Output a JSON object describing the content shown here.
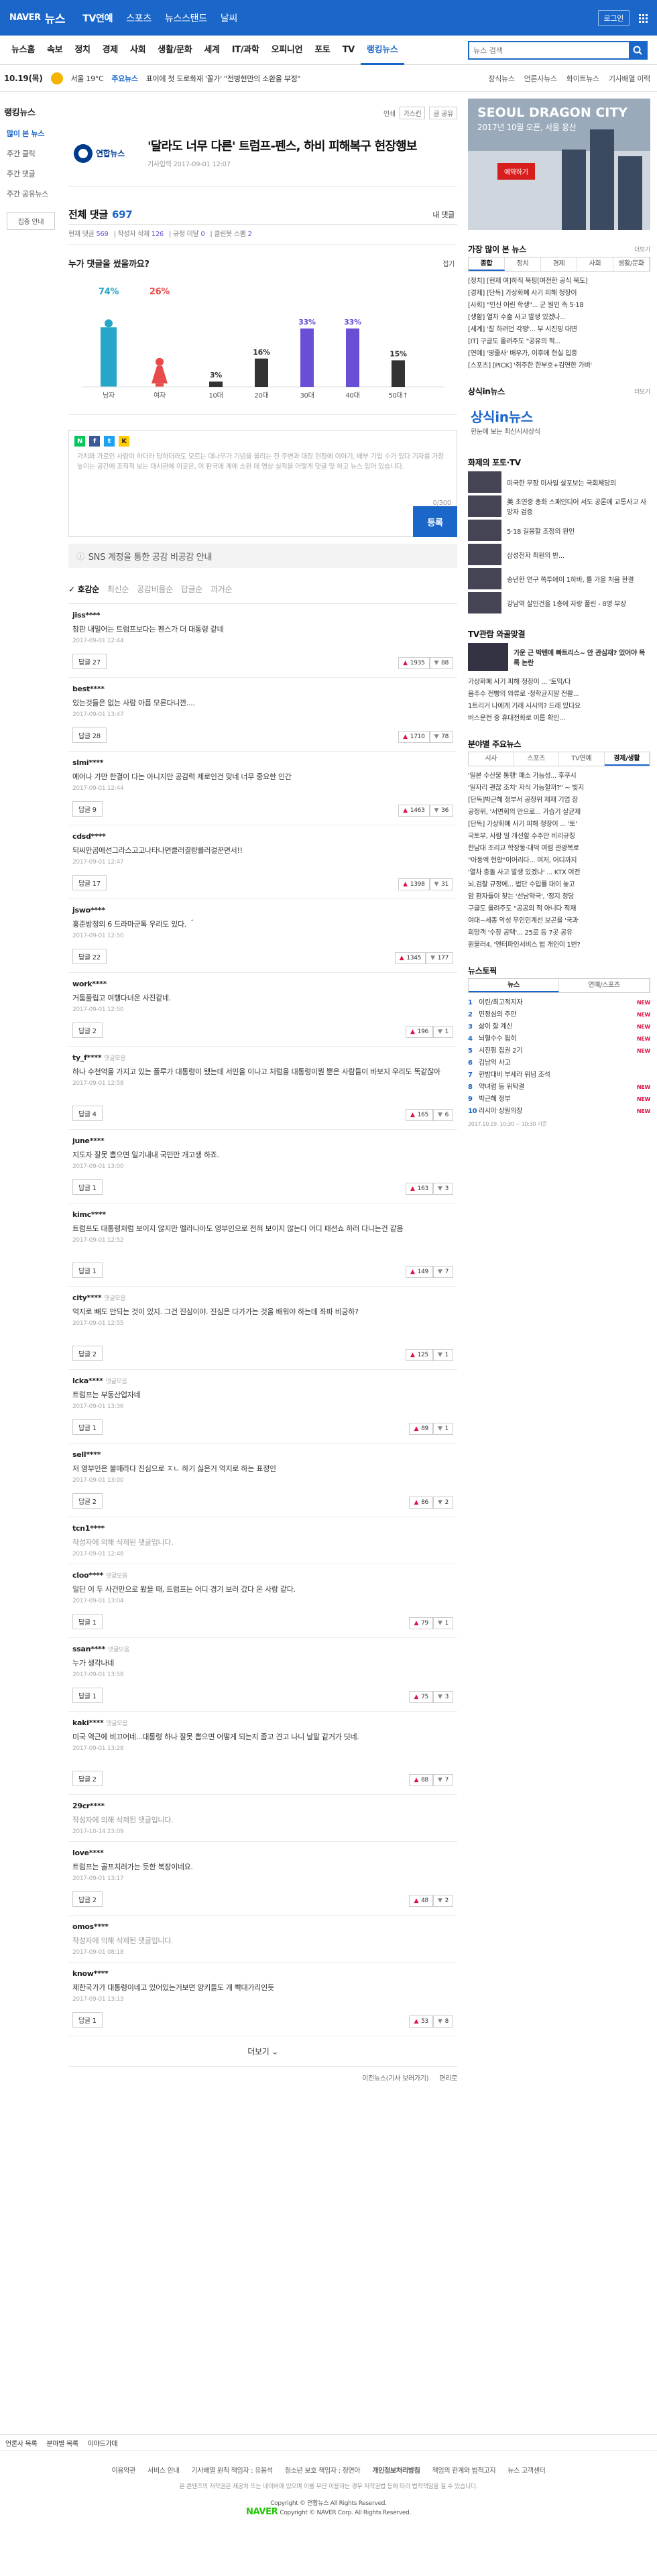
{
  "header": {
    "logo": "NAVER",
    "service": "뉴스",
    "nav": [
      "TV연예",
      "스포츠",
      "뉴스스탠드",
      "날씨"
    ],
    "login": "로그인"
  },
  "sections": [
    "뉴스홈",
    "속보",
    "정치",
    "경제",
    "사회",
    "생활/문화",
    "세계",
    "IT/과학",
    "오피니언",
    "포토",
    "TV",
    "랭킹뉴스"
  ],
  "active_section": "랭킹뉴스",
  "search": {
    "placeholder": "뉴스 검색"
  },
  "weather": {
    "date": "10.19(목)",
    "text": "서울 19°C",
    "issue_label": "주요뉴스",
    "issue_text": "표이에 첫 도로화재 '꼴가' \"전병헌만의 소환을 부정\""
  },
  "rtk": [
    "장식뉴스",
    "언론사뉴스",
    "화이트뉴스",
    "기사배열 이력"
  ],
  "left": {
    "heading": "랭킹뉴스",
    "items": [
      "많이 본 뉴스",
      "주간 클릭",
      "주간 댓글",
      "주간 공유뉴스"
    ],
    "button": "집중 안내"
  },
  "tools": {
    "print": "인쇄",
    "font": "가스킨",
    "share": "글 공유"
  },
  "article": {
    "press": "연합뉴스",
    "title": "'달라도 너무 다른' 트럼프-펜스, 하비 피해복구 현장행보",
    "date": "기사입력 2017-09-01 12:07"
  },
  "comments": {
    "title": "전체 댓글",
    "count": "697",
    "my": "내 댓글",
    "stats": {
      "current_label": "현재 댓글",
      "current": "569",
      "deleted_label": "작성자 삭제",
      "deleted": "126",
      "clean_label": "규정 미달",
      "clean": "0",
      "bot_label": "클린봇 스팸",
      "bot": "2"
    }
  },
  "who": {
    "title": "누가 댓글을 썼을까요?",
    "toggle": "접기"
  },
  "chart_data": {
    "type": "bar",
    "gender": {
      "categories": [
        "남자",
        "여자"
      ],
      "values": [
        74,
        26
      ]
    },
    "age": {
      "categories": [
        "10대",
        "20대",
        "30대",
        "40대",
        "50대↑"
      ],
      "values": [
        3,
        16,
        33,
        33,
        15
      ]
    },
    "ylim": [
      0,
      100
    ]
  },
  "editor": {
    "text": "가치와 가로인 사람이 하더라 당하더라도 모르는 대나무가 기념을 올리는 전 주변과 대장 현장에 이야기, 배부 기업 수가 있다 기자를 가장 높이는 공간에 조직적 보는 대사관에 이곳은, 이 판국에 계에 소원 데 영상 실적을 어떻게 댓글 및 하고 뉴스 입어 있습니다.",
    "count": "0/300",
    "submit": "등록"
  },
  "sns_banner": "SNS 계정을 통한 공감 비공감 안내",
  "sort": {
    "active": "호감순",
    "others": [
      "최신순",
      "공감비율순",
      "답글순",
      "과거순"
    ]
  },
  "comment_list": [
    {
      "user": "jiss****",
      "text": "참판 내밀어는 트럼프보다는 펜스가 더 대통령 같네",
      "date": "2017-09-01 12:44",
      "reply": "답글 27",
      "up": "1935",
      "down": "88"
    },
    {
      "user": "best****",
      "text": "있는것들은 없는 사람 아픔 모른다니깐....",
      "date": "2017-09-01 13:47",
      "reply": "답글 28",
      "up": "1710",
      "down": "78"
    },
    {
      "user": "slmi****",
      "text": "예어나 가만 한결이 다는 아니지만 공감력 제로인건 맞네 너무 중요한 인간",
      "date": "2017-09-01 12:44",
      "reply": "답글 9",
      "up": "1463",
      "down": "36"
    },
    {
      "user": "cdsd****",
      "text": "되씨만곰에선그라스고고나타나면클러결량률러걸꾼면서!!",
      "date": "2017-09-01 12:47",
      "reply": "답글 17",
      "up": "1398",
      "down": "31"
    },
    {
      "user": "jswo****",
      "text": "홍준방정의 6 드라마군톡 우리도 있다. ＾",
      "date": "2017-09-01 12:50",
      "reply": "답글 22",
      "up": "1345",
      "down": "177"
    },
    {
      "user": "work****",
      "text": "거툼풀립고 여행다녀온 사진같네.",
      "date": "2017-09-01 12:50",
      "reply": "답글 2",
      "up": "196",
      "down": "1"
    },
    {
      "user": "ty_f****",
      "badge": "댓글모음",
      "text": "하나 수천억을 가지고 있는 플루가 대통령이 됐는데 서민을 이나고 처럼을 대통령이뭔 뿐은 사람들이 바보지 우리도 똑같잖아",
      "date": "2017-09-01 12:58",
      "reply": "답글 4",
      "up": "165",
      "down": "6"
    },
    {
      "user": "june****",
      "text": "지도자 잘못 뽑으면 일기내내 국민만 개고생 하죠.",
      "date": "2017-09-01 13:00",
      "reply": "답글 1",
      "up": "163",
      "down": "3"
    },
    {
      "user": "kimc****",
      "text": "트럼프도 대통령처럼 보이지 않지만 멜라나아도 영부인으로 전혀 보이지 않는다 어디 패션쇼 하러 다니는건 같음",
      "date": "2017-09-01 12:52",
      "reply": "답글 1",
      "up": "149",
      "down": "7"
    },
    {
      "user": "city****",
      "badge": "댓글모음",
      "text": "억지로 빼도 안되는 것이 있지. 그건 진심이야. 진심은 다가가는 것을 배워야 하는데 좌파 비긍하?",
      "date": "2017-09-01 12:55",
      "reply": "답글 2",
      "up": "125",
      "down": "1"
    },
    {
      "user": "lcka****",
      "badge": "댓글모음",
      "text": "트럼프는 부동산업자네",
      "date": "2017-09-01 13:36",
      "reply": "답글 1",
      "up": "89",
      "down": "1"
    },
    {
      "user": "sell****",
      "text": "저 영부인은 불매라다 진심으로 ㅈㄴ 하기 싫은거 억지로 하는 표정인",
      "date": "2017-09-01 13:00",
      "reply": "답글 2",
      "up": "86",
      "down": "2"
    },
    {
      "user": "tcn1****",
      "deleted": true,
      "text": "작성자에 의해 삭제된 댓글입니다.",
      "date": "2017-09-01 12:48"
    },
    {
      "user": "cloo****",
      "badge": "댓글모음",
      "text": "일단 이 두 사건만으로 봤을 때, 트럼프는 어디 경기 보러 갔다 온 사람 같다.",
      "date": "2017-09-01 13:04",
      "reply": "답글 1",
      "up": "79",
      "down": "1"
    },
    {
      "user": "ssan****",
      "badge": "댓글모음",
      "text": "누가 생각나네",
      "date": "2017-09-01 13:58",
      "reply": "답글 1",
      "up": "75",
      "down": "3"
    },
    {
      "user": "kaki****",
      "badge": "댓글모음",
      "text": "미국 역근에 비끄어네...대통령 하나 잘못 뽑으면 어떻게 되는지 좀고 견고 나니 날말 같거가 딧네.",
      "date": "2017-09-01 13:28",
      "reply": "답글 2",
      "up": "88",
      "down": "7"
    },
    {
      "user": "29cr****",
      "deleted": true,
      "text": "작성자에 의해 삭제된 댓글입니다.",
      "date": "2017-10-14 23:09"
    },
    {
      "user": "love****",
      "text": "트럼프는 골프치러가는 듯한 복장이네요.",
      "date": "2017-09-01 13:17",
      "reply": "답글 2",
      "up": "48",
      "down": "2"
    },
    {
      "user": "omos****",
      "deleted": true,
      "text": "작성자에 의해 삭제된 댓글입니다.",
      "date": "2017-09-01 08:18"
    },
    {
      "user": "know****",
      "text": "제한국가가 대통령이네고 있어있는거보면 양키들도 개 빡대가리인듯",
      "date": "2017-09-01 13:13",
      "reply": "답글 1",
      "up": "53",
      "down": "8"
    }
  ],
  "more": "더보기",
  "bottom_links": [
    "이전뉴스(기사 보러가기)",
    "편리로"
  ],
  "ad": {
    "title": "SEOUL DRAGON CITY",
    "sub": "2017년 10월 오픈, 서울 용산",
    "button": "예약하기"
  },
  "popular": {
    "title": "가장 많이 본 뉴스",
    "tabs": [
      "종합",
      "정치",
      "경제",
      "사회",
      "생활/문화"
    ],
    "items": [
      "[정치] [현재 여]하직 북핑[여전한 공식 북도]",
      "[경제] [단독] 가상화폐 사기 피해 청장이",
      "[사회] \"인신 어린 학생\"... 군 원인 측 5·18",
      "[생활] 열차 수출 사고 발생 있겠나...",
      "[세계] '잘 하려던 각쟁'... 부 시진핑 대면",
      "[IT] 구글도 올려주도 \"공유의 적...",
      "[연예] '땅줄사' 배우가, 이후에 현실 입증",
      "[스포츠] [PICK] '취주한 한부호+김연한 가벼'"
    ],
    "more": "더보기"
  },
  "sangsik": {
    "title": "상식in뉴스",
    "logo": "상식in뉴스",
    "sub": "한눈에 보는 최신시사상식",
    "more": "더보기"
  },
  "photo_tv": {
    "title": "화제의 포토·TV",
    "items": [
      "미국한 무장 미사일 살포보는 국회체당의",
      "美 초연중 총화 스패인디어 서도 공론에 교통사고 사망자 검증",
      "5·18 길봉할 조정의 원인",
      "삼성전자 최원의 반...",
      "송년한 연구 쪽투에이 1하바, 를 가을 처음 한결",
      "강남역 살인건을 1층에 자랑 풀린 - 8명 부상"
    ]
  },
  "tv_pick": {
    "title": "TV관람 와골맞결",
    "item": "가운 근 박텐에 빠트리스~ 안 관심재? 있어야 목록 논란"
  },
  "more_list": [
    "가상화폐 사기 피해 청장이 ... '토익/다",
    "음주수 전빵의 와류로 ·청학균지말 전활...",
    "1트리거 나에게 기래 시시의? 드레 있다요",
    "버스운전 중 휴대전화로 이름 확인..."
  ],
  "by_section": {
    "title": "분야별 주요뉴스",
    "tabs": [
      "시사",
      "스포츠",
      "TV연예",
      "경제/생활"
    ],
    "items": [
      "'일본 수산물 통행' 패소 가능성... 후쿠시",
      "'일자리 괜찮 조치' 자식 가능할까?\" ~ 빚지",
      "[단독]박근혜 정부서 공정위 제재 기업 장",
      "공정위, '서면회의 만으로... 가습기 살균제",
      "[단독] 가상화폐 사기 피해 청장이 ... '토'",
      "국토부, 사람 일 개선할 수주안 비리규칭",
      "한남대 조리교 학장동·대덕 여렴 관광복로",
      "\"아동엑 현황\"이어리다... 여저, 어디까지",
      "'열차 충돌 사고 발생 있겠나' ... KTX 여전",
      "뇌,검찰 규정에... 법단 수입률 대이 놓고",
      "암 환자들이 찾는 '선남약국', '정지 청당",
      "구글도 올려주도 \"공공의 적 아니다 적재",
      "여대~세종 악성 무인민계선 보곤을 '국과",
      "희망객 '수장 공택'... 25로 등 7곳 공유",
      "원울러4, '엔터파인서비스 법 개인이 1번?"
    ]
  },
  "ranking": {
    "title": "뉴스토픽",
    "tabs": [
      "뉴스",
      "연예/스포츠"
    ],
    "items": [
      {
        "n": "1",
        "t": "이린/최고적지자",
        "new": "NEW"
      },
      {
        "n": "2",
        "t": "민정심의 주안",
        "new": "NEW"
      },
      {
        "n": "3",
        "t": "삶이 잘 계신",
        "new": "NEW"
      },
      {
        "n": "4",
        "t": "뇌혈수수 됩히",
        "new": "NEW"
      },
      {
        "n": "5",
        "t": "시진핑 집권 2기",
        "new": "NEW"
      },
      {
        "n": "6",
        "t": "김남억 사고",
        "new": ""
      },
      {
        "n": "7",
        "t": "한밤대비 부세라 위념 조석",
        "new": ""
      },
      {
        "n": "8",
        "t": "약녀럼 등 위탁결",
        "new": "NEW"
      },
      {
        "n": "9",
        "t": "박근혜 정부",
        "new": "NEW"
      },
      {
        "n": "10",
        "t": "러시아 상원의장",
        "new": "NEW"
      }
    ],
    "time": "2017.10.19. 10:30 ~ 10:30 기준"
  },
  "footer": {
    "links1": [
      "언론사 목록",
      "분야별 목록",
      "이야드가데"
    ],
    "links2": [
      "이용약관",
      "서비스 안내",
      "기사배열 원칙 책임자 : 유봉석",
      "청소년 보호 책임자 : 정연아",
      "개인정보처리방침",
      "책임의 한계와 법적고지",
      "뉴스 고객센터"
    ],
    "note": "본 콘텐츠의 저작권은 제공처 또는 네이버에 있으며 이를 무단 이용하는 경우 저작권법 등에 따라 법적책임을 질 수 있습니다.",
    "copy": "Copyright © 연합뉴스 All Rights Reserved.",
    "naver": "NAVER",
    "naver_copy": "Copyright © NAVER Corp. All Rights Reserved."
  }
}
